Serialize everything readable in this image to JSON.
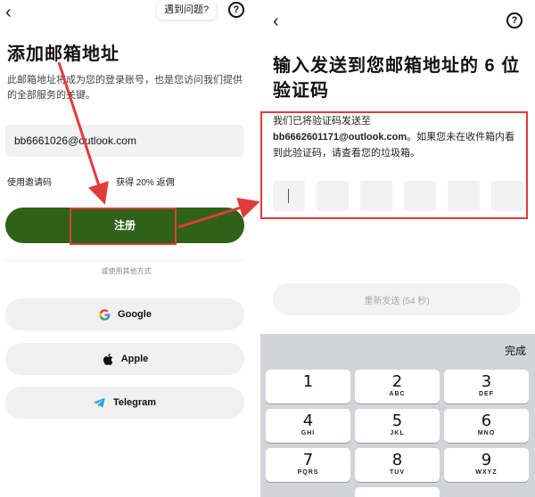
{
  "left": {
    "back_glyph": "‹",
    "tooltip": "遇到问题?",
    "help_glyph": "?",
    "title": "添加邮箱地址",
    "description": "此邮箱地址将成为您的登录账号，也是您访问我们提供的全部服务的关键。",
    "email_value": "bb6661026@outlook.com",
    "invite_label": "使用邀请码",
    "rebate": "获得 20% 返佣",
    "register_label": "注册",
    "divider": "或使用其他方式",
    "social": [
      {
        "label": "Google",
        "icon": "google-icon"
      },
      {
        "label": "Apple",
        "icon": "apple-icon"
      },
      {
        "label": "Telegram",
        "icon": "telegram-icon"
      }
    ]
  },
  "right": {
    "back_glyph": "‹",
    "help_glyph": "?",
    "title": "输入发送到您邮箱地址的 6 位验证码",
    "body_prefix": "我们已将验证码发送至",
    "email": "bb6662601171@outlook.com",
    "body_suffix": "。如果您未在收件箱内看到此验证码，请查看您的垃圾箱。",
    "resend": "重新发送 (54 秒)",
    "keyboard": {
      "done": "完成",
      "keys": [
        {
          "num": "1",
          "letters": ""
        },
        {
          "num": "2",
          "letters": "ABC"
        },
        {
          "num": "3",
          "letters": "DEF"
        },
        {
          "num": "4",
          "letters": "GHI"
        },
        {
          "num": "5",
          "letters": "JKL"
        },
        {
          "num": "6",
          "letters": "MNO"
        },
        {
          "num": "7",
          "letters": "PQRS"
        },
        {
          "num": "8",
          "letters": "TUV"
        },
        {
          "num": "9",
          "letters": "WXYZ"
        }
      ]
    }
  },
  "colors": {
    "primary_green": "#2f6218",
    "annotation_red": "#e23b3b"
  }
}
